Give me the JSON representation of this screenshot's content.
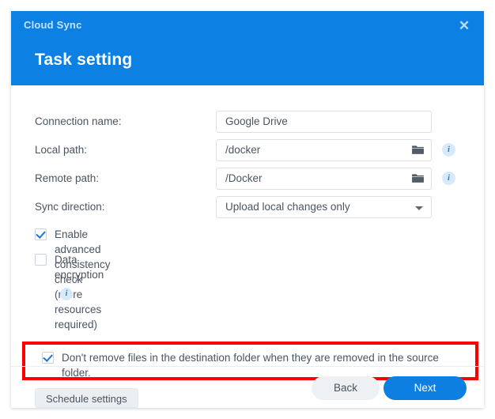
{
  "window": {
    "title": "Cloud Sync",
    "close_icon": "close-icon",
    "page_title": "Task setting",
    "accent_color": "#0c80e3"
  },
  "form": {
    "fields": [
      {
        "label": "Connection name:",
        "value": "Google Drive",
        "type": "text",
        "has_folder_icon": false,
        "has_info": false
      },
      {
        "label": "Local path:",
        "value": "/docker",
        "type": "text",
        "has_folder_icon": true,
        "has_info": true,
        "info_label": "i"
      },
      {
        "label": "Remote path:",
        "value": "/Docker",
        "type": "text",
        "has_folder_icon": true,
        "has_info": true,
        "info_label": "i"
      },
      {
        "label": "Sync direction:",
        "value": "Upload local changes only",
        "type": "select",
        "has_folder_icon": false,
        "has_info": false
      }
    ],
    "checkboxes": [
      {
        "label": "Enable advanced consistency check (more resources required)",
        "checked": true,
        "has_info": false,
        "info_label": ""
      },
      {
        "label": "Data encryption",
        "checked": false,
        "has_info": true,
        "info_label": "i"
      },
      {
        "label": "Don't remove files in the destination folder when they are removed in the source folder.",
        "checked": true,
        "has_info": false,
        "info_label": "",
        "highlighted": true
      }
    ],
    "schedule_button": "Schedule settings"
  },
  "highlight": {
    "color": "#fc0000"
  },
  "footer": {
    "back_label": "Back",
    "next_label": "Next"
  }
}
